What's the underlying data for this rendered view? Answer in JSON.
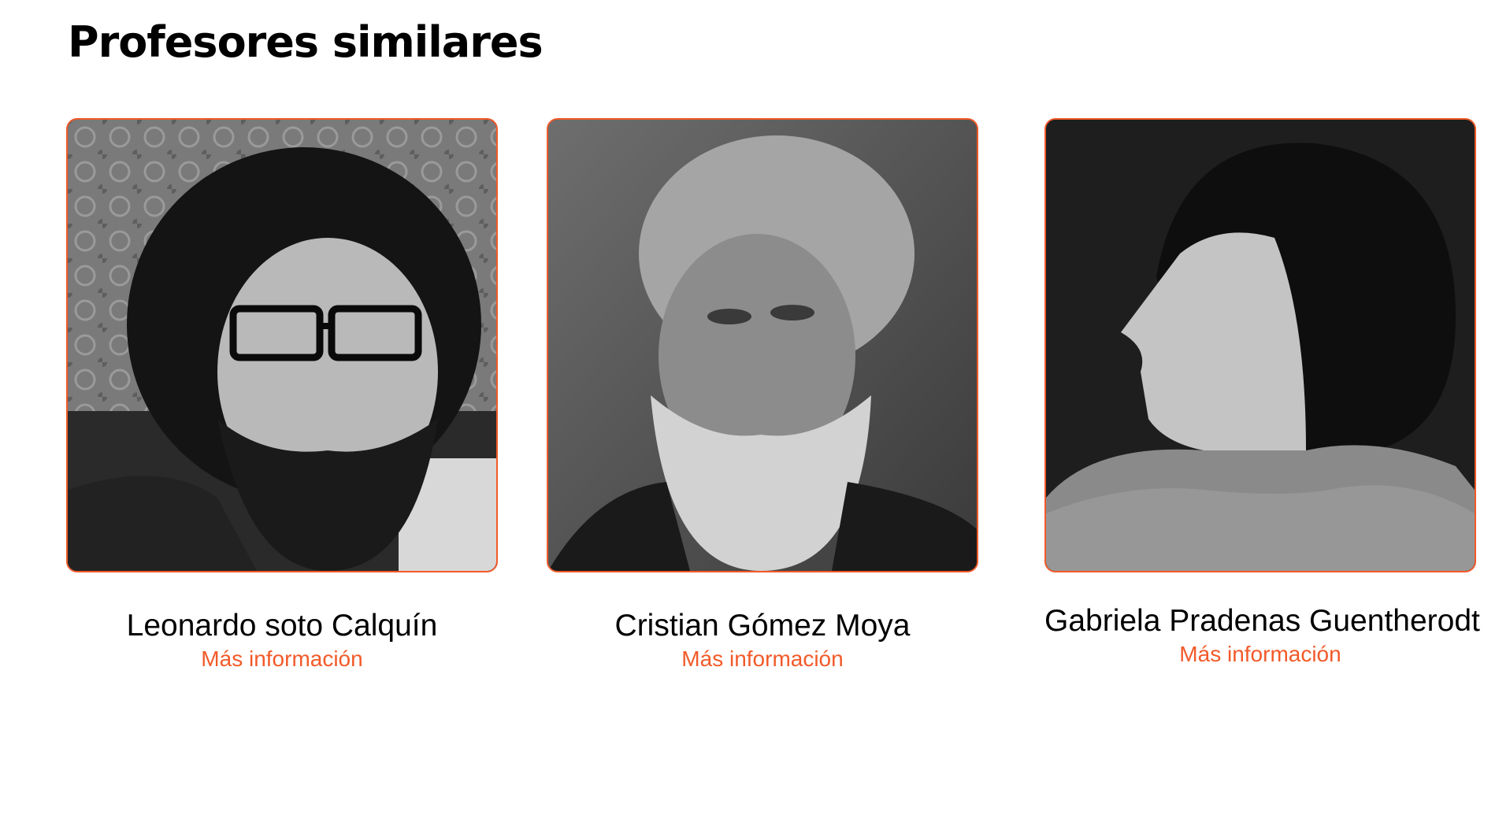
{
  "section": {
    "title": "Profesores similares"
  },
  "professors": [
    {
      "name": "Leonardo soto Calquín",
      "link_label": "Más información",
      "photo_icon": "portrait-photo"
    },
    {
      "name": "Cristian Gómez Moya",
      "link_label": "Más información",
      "photo_icon": "portrait-photo"
    },
    {
      "name": "Gabriela Pradenas Guentherodt",
      "link_label": "Más información",
      "photo_icon": "portrait-photo"
    }
  ],
  "colors": {
    "accent": "#f25a29",
    "text": "#000000",
    "background": "#ffffff"
  }
}
